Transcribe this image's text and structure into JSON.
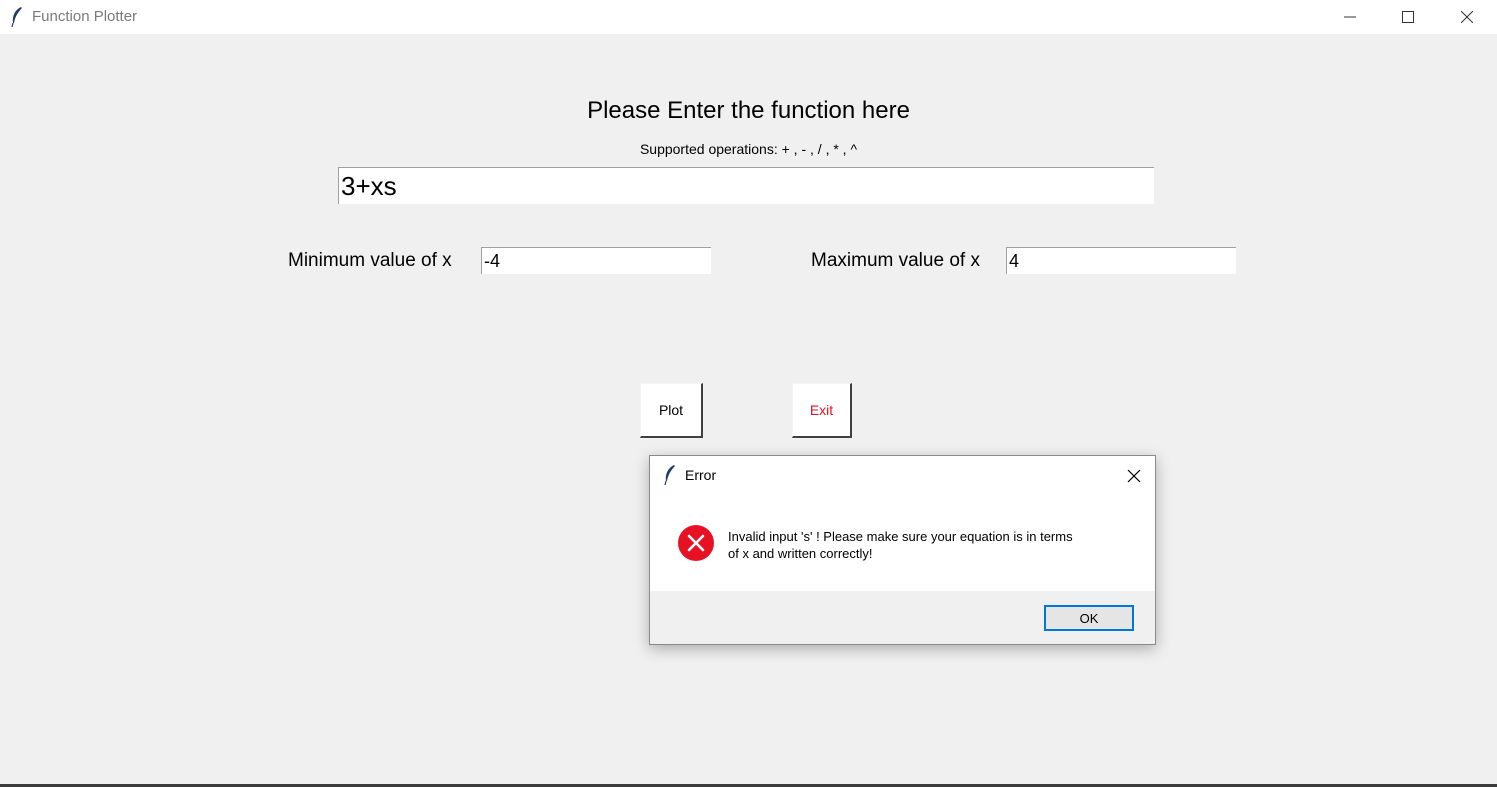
{
  "window": {
    "title": "Function Plotter",
    "icons": [
      "feather-icon",
      "minimize-icon",
      "maximize-icon",
      "close-icon"
    ]
  },
  "form": {
    "heading": "Please Enter the function here",
    "supported_ops": "Supported operations: + , - , / , * , ^",
    "function_value": "3+xs",
    "min_label": "Minimum value of x",
    "min_value": "-4",
    "max_label": "Maximum value of x",
    "max_value": "4",
    "plot_label": "Plot",
    "exit_label": "Exit",
    "exit_color": "#e81123"
  },
  "error_dialog": {
    "title": "Error",
    "message": "Invalid input 's'  ! Please make sure your equation is in terms\nof x and written correctly!",
    "ok_label": "OK",
    "icon": "error-circle-icon",
    "icon_color": "#e81123",
    "focus_color": "#0078d7"
  }
}
